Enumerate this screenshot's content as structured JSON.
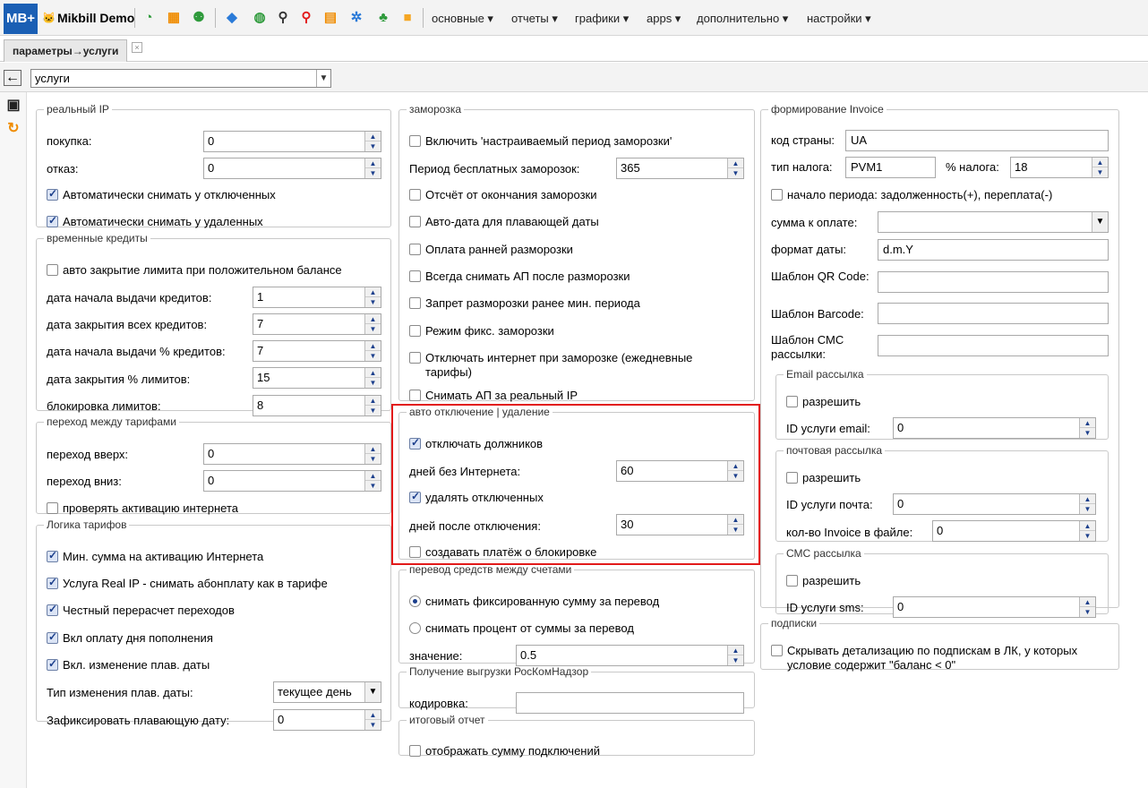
{
  "app": {
    "logo": "MB+",
    "brand": "Mikbill Demo",
    "cat": "🐱"
  },
  "menus": [
    "основные ▾",
    "отчеты ▾",
    "графики ▾",
    "apps ▾",
    "дополнительно ▾",
    "настройки ▾"
  ],
  "tab": {
    "label": "параметры→услуги",
    "close": "×"
  },
  "path": {
    "selected": "услуги"
  },
  "realip": {
    "legend": "реальный IP",
    "buy_label": "покупка:",
    "buy": "0",
    "refuse_label": "отказ:",
    "refuse": "0",
    "auto_off": "Автоматически снимать у отключенных",
    "auto_del": "Автоматически снимать у удаленных"
  },
  "credits": {
    "legend": "временные кредиты",
    "auto_close": "авто закрытие лимита при положительном балансе",
    "start_label": "дата начала выдачи кредитов:",
    "start": "1",
    "close_label": "дата закрытия всех кредитов:",
    "close": "7",
    "pstart_label": "дата начала выдачи % кредитов:",
    "pstart": "7",
    "pclose_label": "дата закрытия % лимитов:",
    "pclose": "15",
    "block_label": "блокировка лимитов:",
    "block": "8"
  },
  "transfer_tariff": {
    "legend": "переход между тарифами",
    "up_label": "переход вверх:",
    "up": "0",
    "down_label": "переход вниз:",
    "down": "0",
    "check": "проверять активацию интернета"
  },
  "logic": {
    "legend": "Логика тарифов",
    "min_sum": "Мин. сумма на активацию Интернета",
    "realip": "Услуга Real IP - снимать абонплату как в тарифе",
    "fair": "Честный перерасчет переходов",
    "daypay": "Вкл оплату дня пополнения",
    "float": "Вкл. изменение плав. даты",
    "type_label": "Тип изменения плав. даты:",
    "type": "текущее день",
    "fix_label": "Зафиксировать плавающую дату:",
    "fix": "0"
  },
  "freeze": {
    "legend": "заморозка",
    "custom": "Включить 'настраиваемый период заморозки'",
    "period_label": "Период бесплатных заморозок:",
    "period": "365",
    "countdown": "Отсчёт от окончания заморозки",
    "autodate": "Авто-дата для плавающей даты",
    "early": "Оплата ранней разморозки",
    "always_ap": "Всегда снимать АП после разморозки",
    "forbid": "Запрет разморозки ранее мин. периода",
    "fixmode": "Режим фикс. заморозки",
    "netoff": "Отключать интернет при заморозке (ежедневные тарифы)",
    "realip_ap": "Снимать АП за реальный IP"
  },
  "autooff": {
    "legend": "авто отключение | удаление",
    "debtors": "отключать должников",
    "days_no_inet_label": "дней без Интернета:",
    "days_no_inet": "60",
    "del_off": "удалять отключенных",
    "days_after_label": "дней после отключения:",
    "days_after": "30",
    "payment": "создавать платёж о блокировке"
  },
  "moneytransfer": {
    "legend": "перевод средств между счетами",
    "fixed": "снимать фиксированную сумму за перевод",
    "percent": "снимать процент от суммы за перевод",
    "value_label": "значение:",
    "value": "0.5"
  },
  "rkn": {
    "legend": "Получение выгрузки РосКомНадзор",
    "enc_label": "кодировка:",
    "enc": ""
  },
  "summary": {
    "legend": "итоговый отчет",
    "show": "отображать сумму подключений"
  },
  "invoice": {
    "legend": "формирование Invoice",
    "country_label": "код страны:",
    "country": "UA",
    "tax_label": "тип налога:",
    "tax": "PVM1",
    "taxp_label": "% налога:",
    "taxp": "18",
    "period": "начало периода: задолженность(+), переплата(-)",
    "sum_label": "сумма к оплате:",
    "sum": "",
    "date_label": "формат даты:",
    "date": "d.m.Y",
    "qr_label": "Шаблон QR Code:",
    "qr": "",
    "barcode_label": "Шаблон Barcode:",
    "barcode": "",
    "sms_label": "Шаблон СМС рассылки:",
    "sms": ""
  },
  "email": {
    "legend": "Email рассылка",
    "allow": "разрешить",
    "id_label": "ID услуги email:",
    "id": "0"
  },
  "post": {
    "legend": "почтовая рассылка",
    "allow": "разрешить",
    "id_label": "ID услуги почта:",
    "id": "0",
    "count_label": "кол-во Invoice в файле:",
    "count": "0"
  },
  "smsmail": {
    "legend": "СМС рассылка",
    "allow": "разрешить",
    "id_label": "ID услуги sms:",
    "id": "0"
  },
  "subs": {
    "legend": "подписки",
    "hide": "Скрывать детализацию по подпискам в ЛК, у которых условие содержит \"баланс < 0\""
  },
  "icons": [
    "dashboard-icon",
    "calendar-icon",
    "add-user-icon",
    "tag-icon",
    "globe-icon",
    "search-icon",
    "search-red-icon",
    "clipboard-icon",
    "gears-icon",
    "network-icon",
    "note-icon",
    "save-icon",
    "refresh-icon",
    "back-icon"
  ],
  "colors": {
    "accent": "#1a5fb4",
    "highlight": "#e21a1a"
  }
}
